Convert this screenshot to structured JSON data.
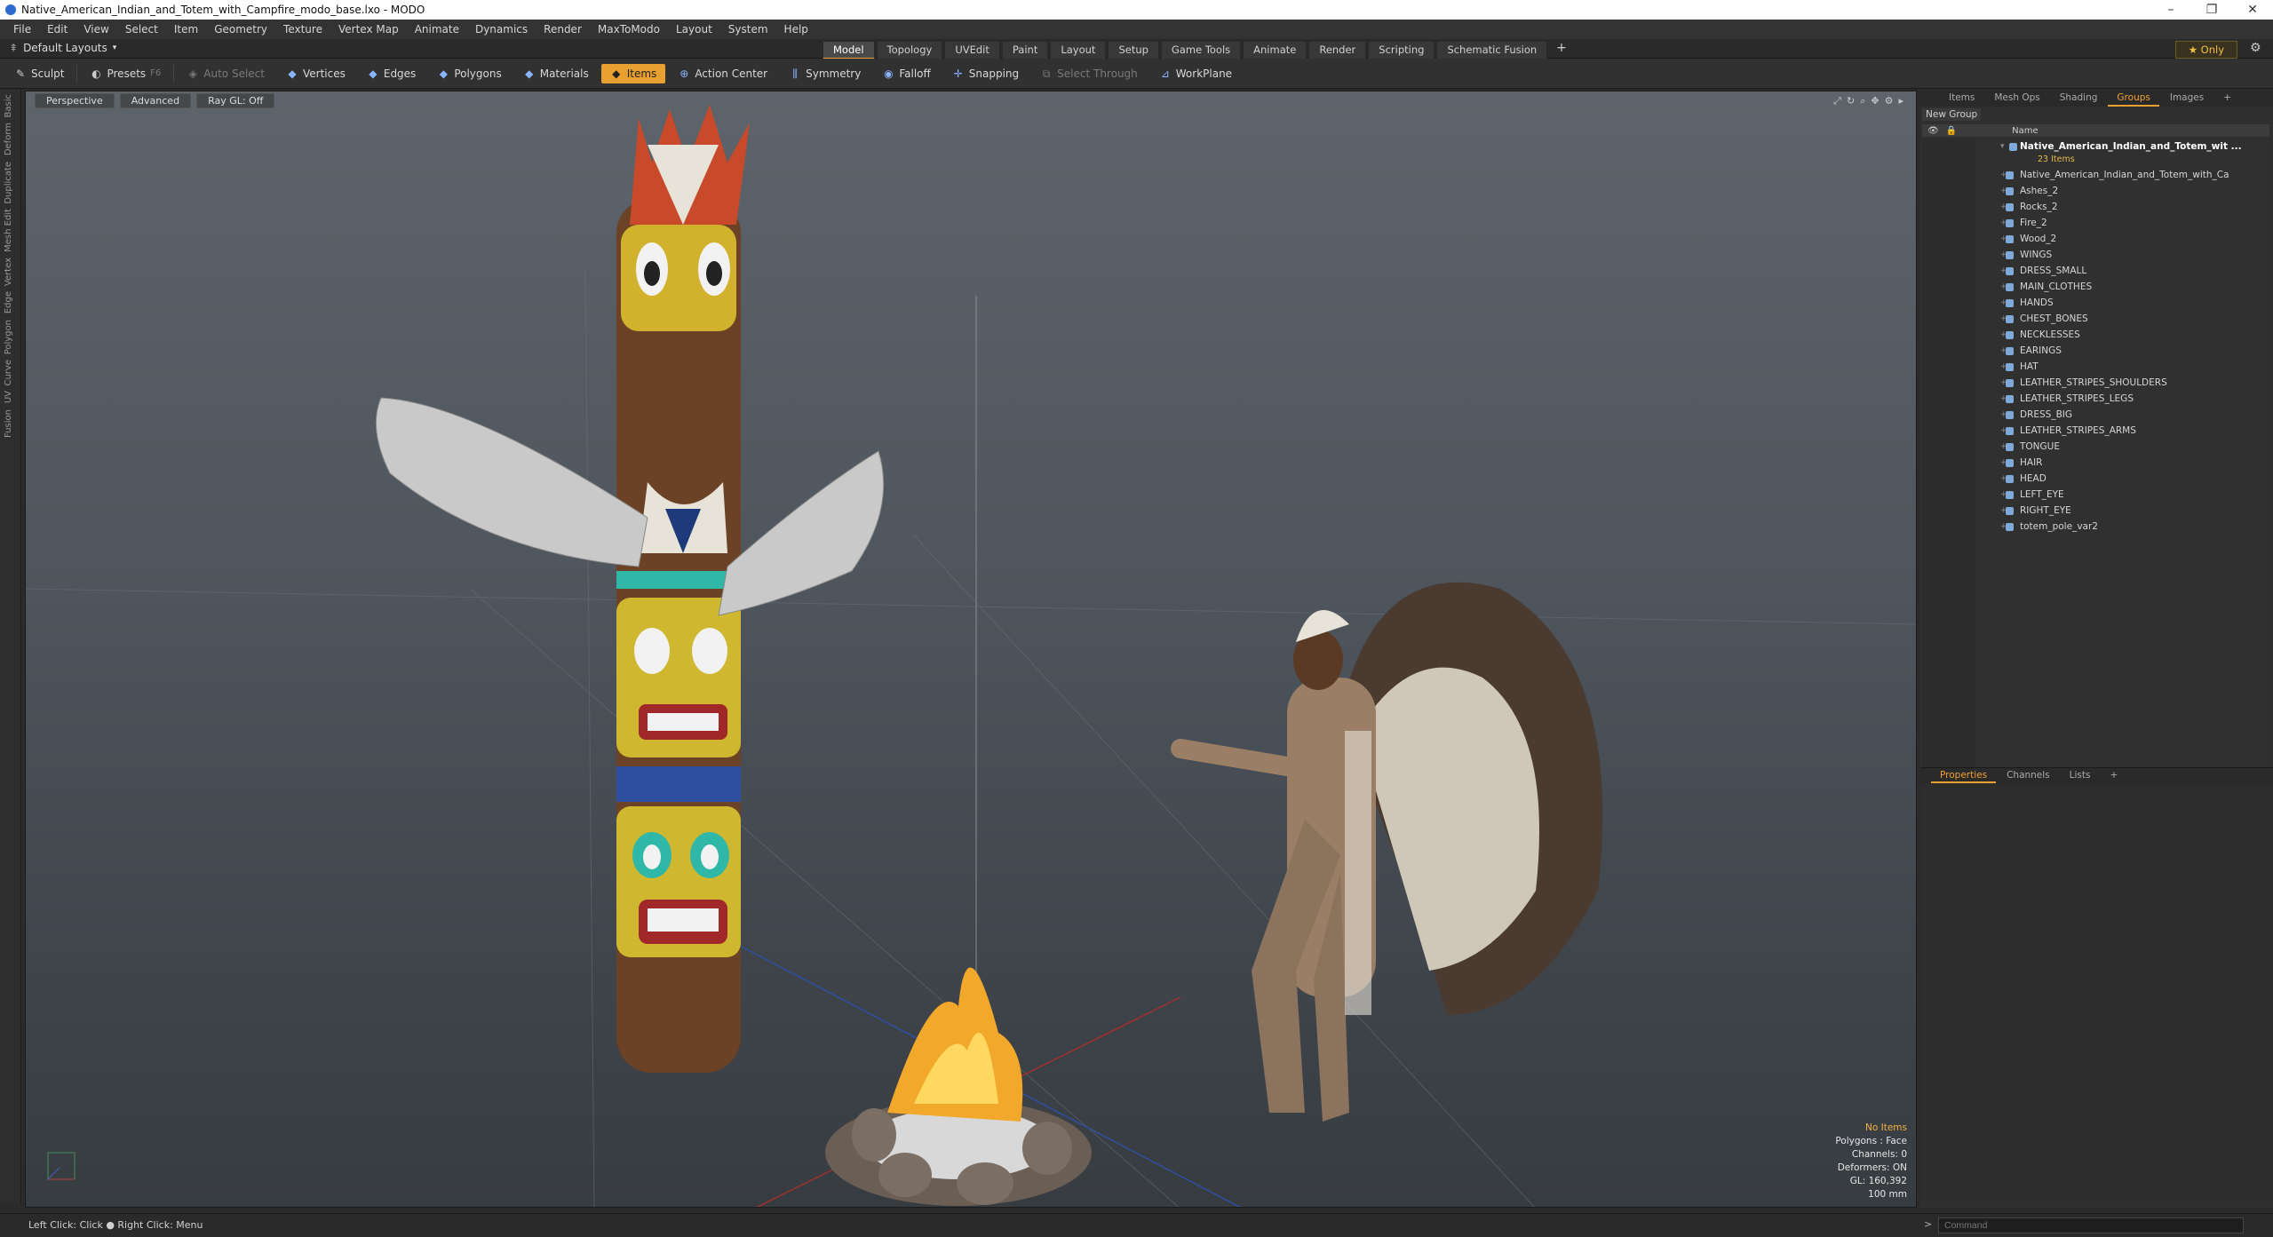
{
  "window": {
    "title": "Native_American_Indian_and_Totem_with_Campfire_modo_base.lxo - MODO",
    "controls": [
      "–",
      "❐",
      "✕"
    ]
  },
  "menu": [
    "File",
    "Edit",
    "View",
    "Select",
    "Item",
    "Geometry",
    "Texture",
    "Vertex Map",
    "Animate",
    "Dynamics",
    "Render",
    "MaxToModo",
    "Layout",
    "System",
    "Help"
  ],
  "layoutbar": {
    "layouts_label": "Default Layouts",
    "tabs": [
      "Model",
      "Topology",
      "UVEdit",
      "Paint",
      "Layout",
      "Setup",
      "Game Tools",
      "Animate",
      "Render",
      "Scripting",
      "Schematic Fusion"
    ],
    "active_tab": "Model",
    "plus": "+",
    "only_label": "Only"
  },
  "toolbar": {
    "sculpt": "Sculpt",
    "presets": "Presets",
    "presets_key": "F6",
    "auto_select": "Auto Select",
    "vertices": "Vertices",
    "edges": "Edges",
    "polygons": "Polygons",
    "materials": "Materials",
    "items": "Items",
    "action_center": "Action Center",
    "symmetry": "Symmetry",
    "falloff": "Falloff",
    "snapping": "Snapping",
    "select_through": "Select Through",
    "workplane": "WorkPlane"
  },
  "left_strip": [
    "Basic",
    "Deform",
    "Duplicate",
    "Mesh Edit",
    "Vertex",
    "Edge",
    "Polygon",
    "Curve",
    "UV",
    "Fusion"
  ],
  "viewport": {
    "view_mode": "Perspective",
    "shading": "Advanced",
    "raygl": "Ray GL: Off",
    "stats": {
      "no_items": "No Items",
      "polygons": "Polygons : Face",
      "channels": "Channels: 0",
      "deformers": "Deformers: ON",
      "gl": "GL: 160,392",
      "scale": "100 mm"
    }
  },
  "items_panel": {
    "tabs": [
      "Items",
      "Mesh Ops",
      "Shading",
      "Groups",
      "Images",
      "+"
    ],
    "active_tab": "Groups",
    "new_group": "New Group",
    "column_name": "Name",
    "root": "Native_American_Indian_and_Totem_wit ...",
    "root_count": "23 Items",
    "children": [
      "Native_American_Indian_and_Totem_with_Ca",
      "Ashes_2",
      "Rocks_2",
      "Fire_2",
      "Wood_2",
      "WINGS",
      "DRESS_SMALL",
      "MAIN_CLOTHES",
      "HANDS",
      "CHEST_BONES",
      "NECKLESSES",
      "EARINGS",
      "HAT",
      "LEATHER_STRIPES_SHOULDERS",
      "LEATHER_STRIPES_LEGS",
      "DRESS_BIG",
      "LEATHER_STRIPES_ARMS",
      "TONGUE",
      "HAIR",
      "HEAD",
      "LEFT_EYE",
      "RIGHT_EYE",
      "totem_pole_var2"
    ]
  },
  "properties_panel": {
    "tabs": [
      "Properties",
      "Channels",
      "Lists",
      "+"
    ],
    "active_tab": "Properties"
  },
  "statusbar": {
    "hint": "Left Click: Click ● Right Click: Menu",
    "command_placeholder": "Command",
    "prompt": ">"
  },
  "colors": {
    "accent": "#e8a030",
    "viewport_top": "#5d646b",
    "viewport_bottom": "#373c41"
  }
}
